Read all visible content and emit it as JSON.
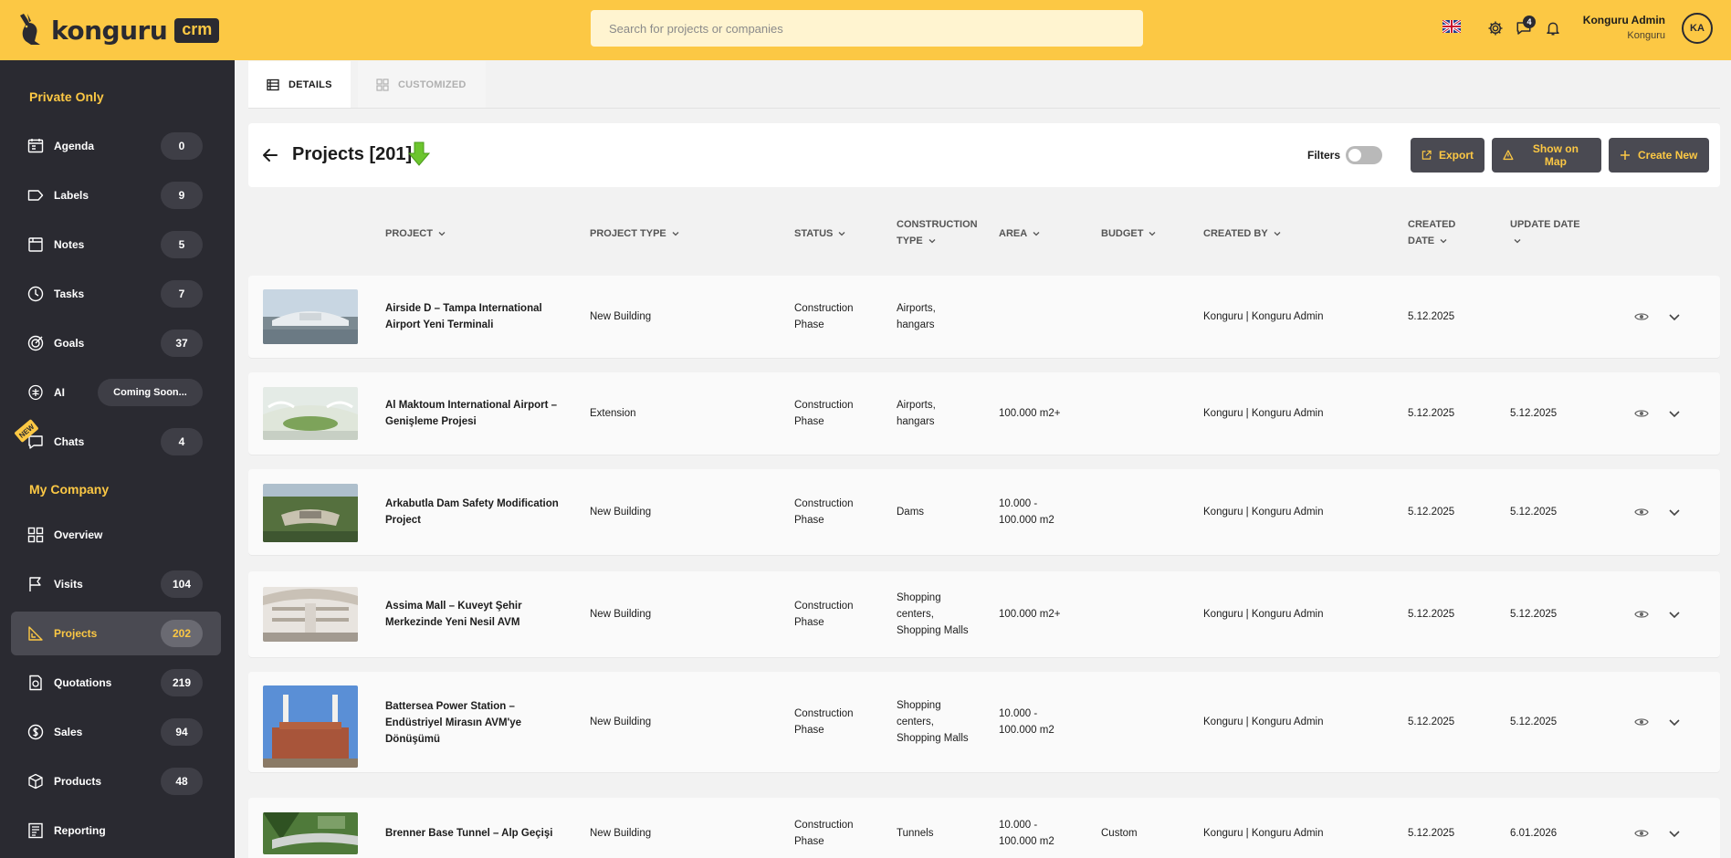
{
  "app": {
    "brand": "konguru",
    "product": "crm"
  },
  "search": {
    "placeholder": "Search for projects or companies"
  },
  "topbar": {
    "messages_badge": "4",
    "user_name": "Konguru Admin",
    "user_company": "Konguru",
    "avatar_initials": "KA"
  },
  "sidebar": {
    "private_title": "Private Only",
    "company_title": "My Company",
    "new_tag": "NEW",
    "private_items": [
      {
        "label": "Agenda",
        "count": "0",
        "icon": "agenda-icon"
      },
      {
        "label": "Labels",
        "count": "9",
        "icon": "label-icon"
      },
      {
        "label": "Notes",
        "count": "5",
        "icon": "notes-icon"
      },
      {
        "label": "Tasks",
        "count": "7",
        "icon": "tasks-icon"
      },
      {
        "label": "Goals",
        "count": "37",
        "icon": "goals-icon"
      },
      {
        "label": "AI",
        "count": "Coming Soon...",
        "icon": "ai-icon"
      },
      {
        "label": "Chats",
        "count": "4",
        "icon": "chat-icon"
      }
    ],
    "company_items": [
      {
        "label": "Overview",
        "count": "",
        "icon": "grid-icon"
      },
      {
        "label": "Visits",
        "count": "104",
        "icon": "flag-icon"
      },
      {
        "label": "Projects",
        "count": "202",
        "icon": "projects-icon",
        "active": true
      },
      {
        "label": "Quotations",
        "count": "219",
        "icon": "quotation-icon"
      },
      {
        "label": "Sales",
        "count": "94",
        "icon": "sales-icon"
      },
      {
        "label": "Products",
        "count": "48",
        "icon": "box-icon"
      },
      {
        "label": "Reporting",
        "count": "",
        "icon": "report-icon"
      }
    ]
  },
  "tabs": [
    {
      "label": "DETAILS",
      "active": true
    },
    {
      "label": "CUSTOMIZED",
      "active": false
    }
  ],
  "header": {
    "title": "Projects [201]",
    "filters_label": "Filters",
    "export_label": "Export",
    "map_label": "Show on Map",
    "create_label": "Create New"
  },
  "columns": {
    "project": "PROJECT",
    "project_type": "PROJECT TYPE",
    "status": "STATUS",
    "construction_type_1": "CONSTRUCTION",
    "construction_type_2": "TYPE",
    "area": "AREA",
    "budget": "BUDGET",
    "created_by": "CREATED BY",
    "created_date_1": "CREATED",
    "created_date_2": "DATE",
    "update_date": "UPDATE DATE"
  },
  "rows": [
    {
      "project": [
        "Airside D – Tampa International",
        "Airport Yeni Terminali"
      ],
      "type": "New Building",
      "status": [
        "Construction",
        "Phase"
      ],
      "ctype": [
        "Airports,",
        "hangars"
      ],
      "area": [],
      "budget": "",
      "created_by": "Konguru | Konguru Admin",
      "created": "5.12.2025",
      "updated": ""
    },
    {
      "project": [
        "Al Maktoum International Airport –",
        "Genişleme Projesi"
      ],
      "type": "Extension",
      "status": [
        "Construction",
        "Phase"
      ],
      "ctype": [
        "Airports,",
        "hangars"
      ],
      "area": [
        "100.000 m2+"
      ],
      "budget": "",
      "created_by": "Konguru | Konguru Admin",
      "created": "5.12.2025",
      "updated": "5.12.2025"
    },
    {
      "project": [
        "Arkabutla Dam Safety Modification",
        "Project"
      ],
      "type": "New Building",
      "status": [
        "Construction",
        "Phase"
      ],
      "ctype": [
        "Dams"
      ],
      "area": [
        "10.000 -",
        "100.000 m2"
      ],
      "budget": "",
      "created_by": "Konguru | Konguru Admin",
      "created": "5.12.2025",
      "updated": "5.12.2025"
    },
    {
      "project": [
        "Assima Mall – Kuveyt Şehir",
        "Merkezinde Yeni Nesil AVM"
      ],
      "type": "New Building",
      "status": [
        "Construction",
        "Phase"
      ],
      "ctype": [
        "Shopping",
        "centers,",
        "Shopping Malls"
      ],
      "area": [
        "100.000 m2+"
      ],
      "budget": "",
      "created_by": "Konguru | Konguru Admin",
      "created": "5.12.2025",
      "updated": "5.12.2025"
    },
    {
      "project": [
        "Battersea Power Station –",
        "Endüstriyel Mirasın AVM'ye",
        "Dönüşümü"
      ],
      "type": "New Building",
      "status": [
        "Construction",
        "Phase"
      ],
      "ctype": [
        "Shopping",
        "centers,",
        "Shopping Malls"
      ],
      "area": [
        "10.000 -",
        "100.000 m2"
      ],
      "budget": "",
      "created_by": "Konguru | Konguru Admin",
      "created": "5.12.2025",
      "updated": "5.12.2025"
    },
    {
      "project": [
        "Brenner Base Tunnel – Alp Geçişi"
      ],
      "type": "New Building",
      "status": [
        "Construction",
        "Phase"
      ],
      "ctype": [
        "Tunnels"
      ],
      "area": [
        "10.000 -",
        "100.000 m2"
      ],
      "budget": "Custom",
      "created_by": "Konguru | Konguru Admin",
      "created": "5.12.2025",
      "updated": "6.01.2026"
    }
  ]
}
